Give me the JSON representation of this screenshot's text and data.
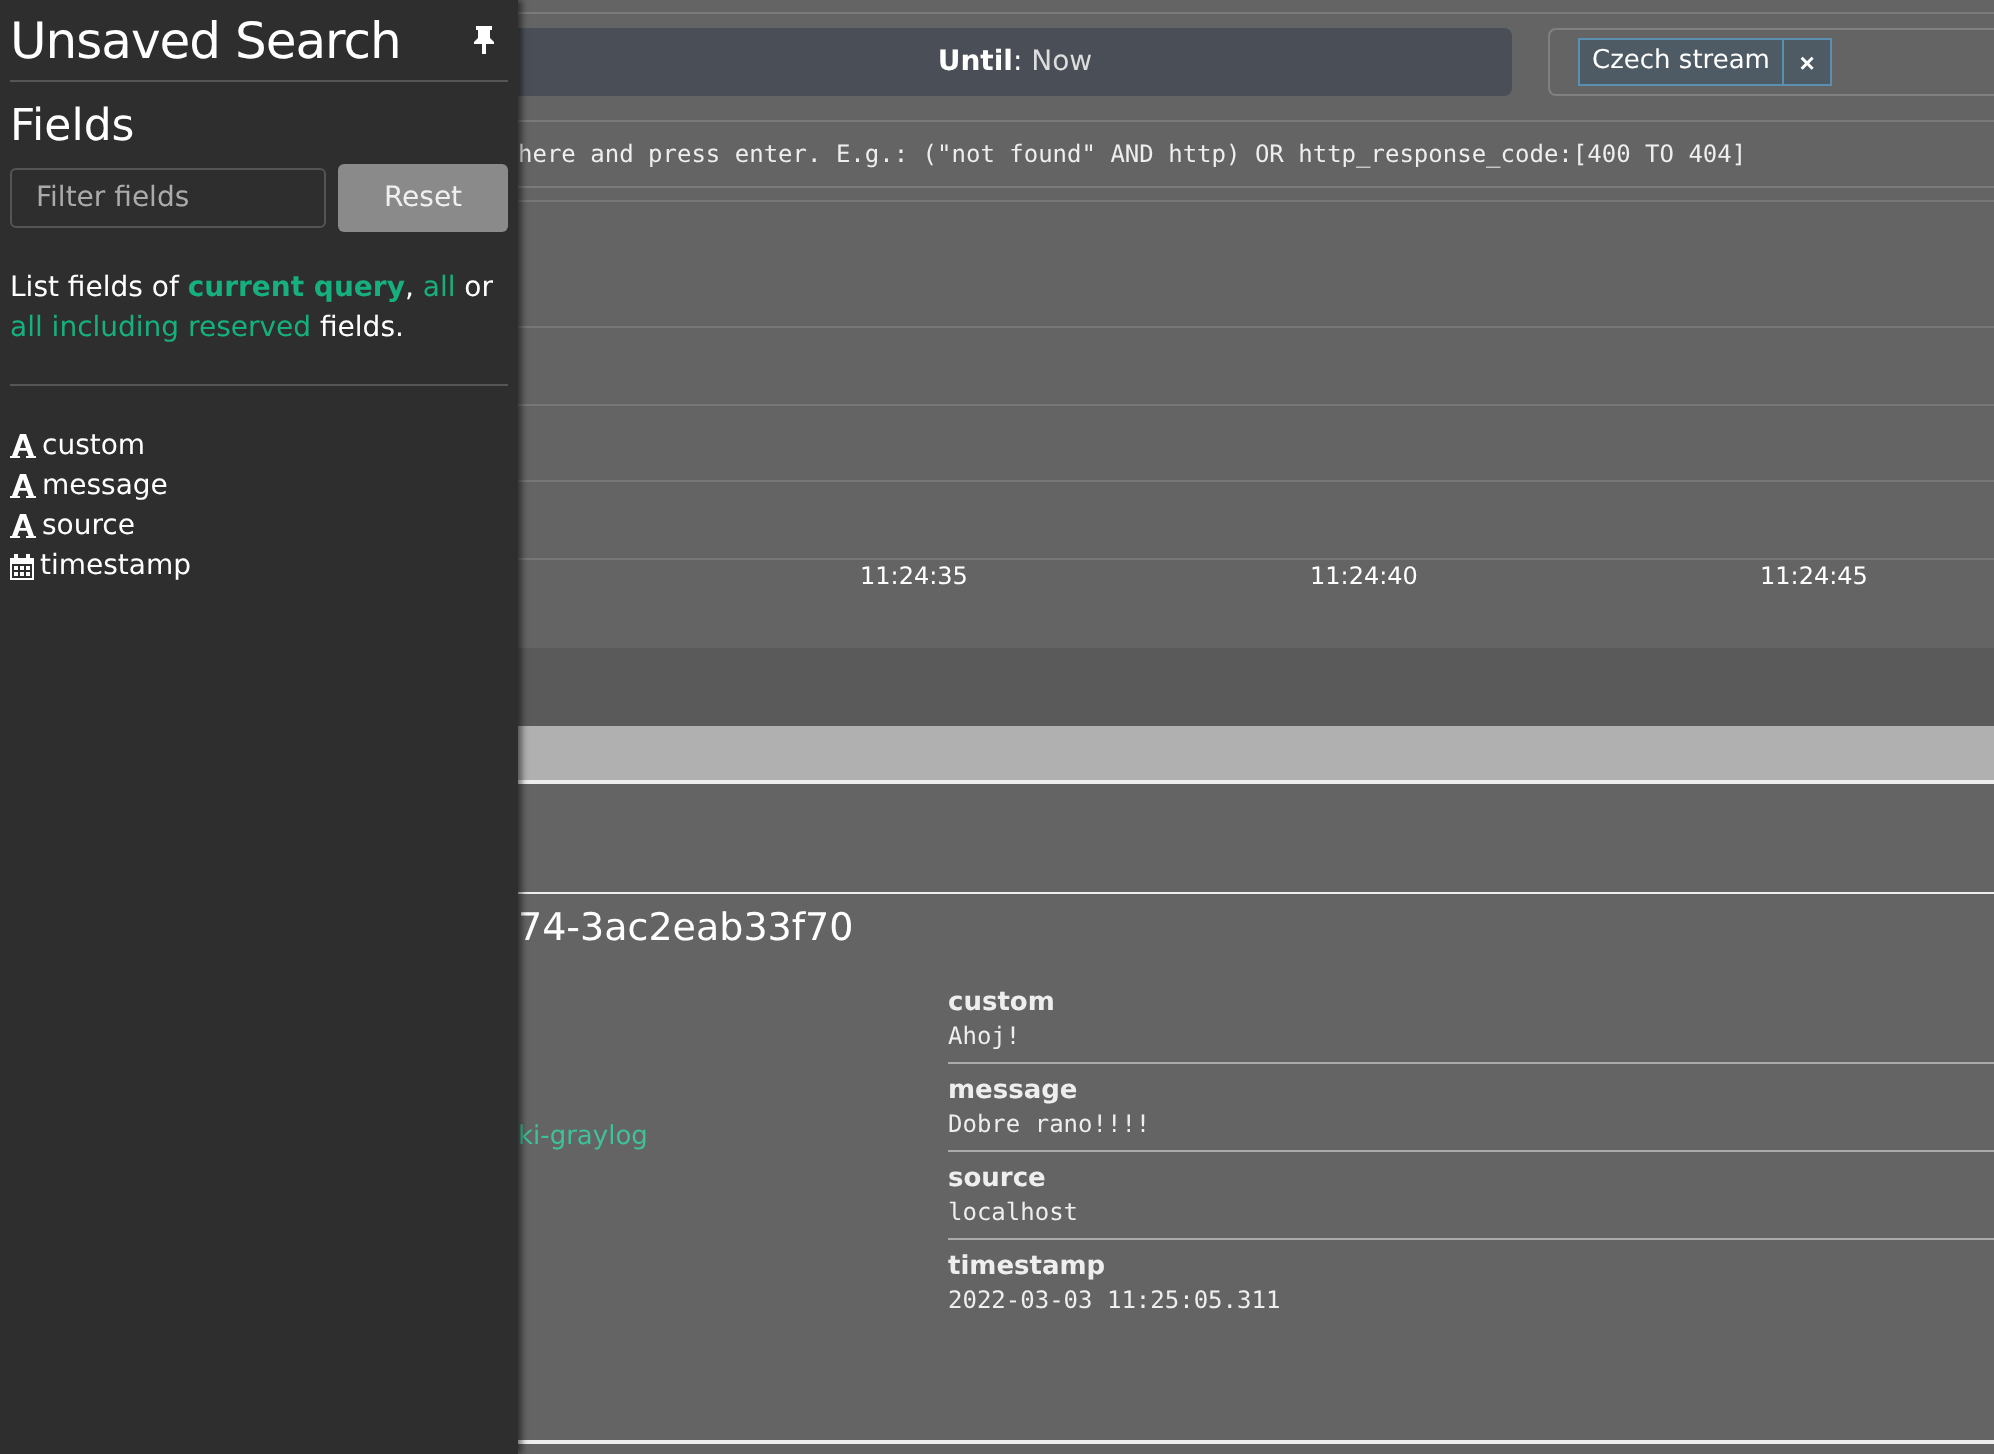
{
  "sidebar": {
    "title": "Unsaved Search",
    "pinned": true,
    "section_title": "Fields",
    "filter": {
      "placeholder": "Filter fields"
    },
    "reset_button": "Reset",
    "hint": {
      "prefix": "List fields of ",
      "links": [
        {
          "label": "current query",
          "selected": true
        },
        {
          "label": "all",
          "selected": false
        },
        {
          "label": "all including reserved",
          "selected": false
        }
      ],
      "sep1": ", ",
      "sep2": " or ",
      "suffix": " fields."
    },
    "fields": [
      {
        "name": "custom",
        "kind": "string"
      },
      {
        "name": "message",
        "kind": "string"
      },
      {
        "name": "source",
        "kind": "string"
      },
      {
        "name": "timestamp",
        "kind": "date"
      }
    ]
  },
  "time_range": {
    "label": "Until",
    "separator": ":",
    "value": "Now"
  },
  "streams": [
    {
      "name": "Czech stream"
    }
  ],
  "remove_symbol": "×",
  "query_placeholder": "here and press enter. E.g.: (\"not found\" AND http) OR http_response_code:[400 TO 404]",
  "axis_ticks": [
    "11:24:35",
    "11:24:40",
    "11:24:45"
  ],
  "message": {
    "id": "74-3ac2eab33f70",
    "stream_link": "ki-graylog",
    "fields": [
      {
        "name": "custom",
        "value": "Ahoj!"
      },
      {
        "name": "message",
        "value": "Dobre rano!!!!"
      },
      {
        "name": "source",
        "value": "localhost"
      },
      {
        "name": "timestamp",
        "value": "2022-03-03 11:25:05.311"
      }
    ]
  }
}
